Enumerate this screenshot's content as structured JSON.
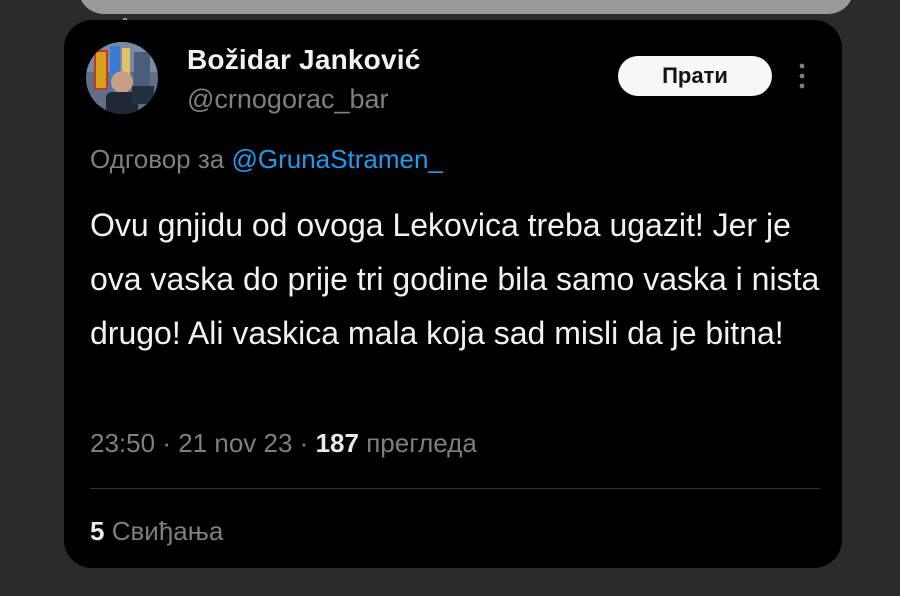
{
  "tweet": {
    "author": {
      "display_name": "Božidar Janković",
      "handle": "@crnogorac_bar",
      "avatar_icon": "profile-photo"
    },
    "follow_button_label": "Прати",
    "more_icon": "more-vertical-icon",
    "reply_prefix": "Одговор за",
    "reply_to": "@GrunaStramen_",
    "text": "Ovu gnjidu od ovoga Lekovica treba ugazit! Jer je ova vaska do prije tri godine bila samo vaska i nista drugo! Ali vaskica mala koja sad misli da je bitna!",
    "time": "23:50",
    "date": "21 nov 23",
    "separator": "·",
    "views_count": "187",
    "views_label": "прегледа",
    "likes_count": "5",
    "likes_label": "Свиђања"
  },
  "colors": {
    "background": "#2b2b2e",
    "card": "#000000",
    "text_primary": "#f2f2f2",
    "text_secondary": "#7d7f83",
    "mention": "#1d9bf0",
    "button_bg": "#f7f7f7"
  }
}
